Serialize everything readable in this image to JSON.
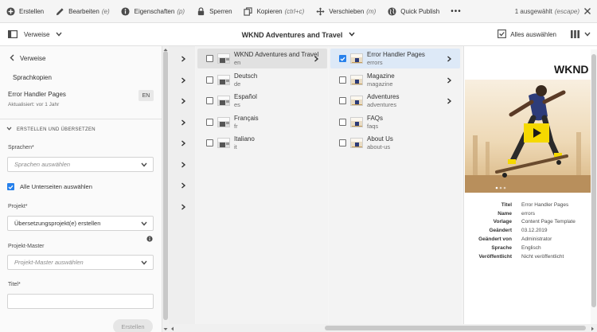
{
  "actionbar": {
    "create": "Erstellen",
    "edit": "Bearbeiten",
    "edit_kbd": "(e)",
    "properties": "Eigenschaften",
    "properties_kbd": "(p)",
    "lock": "Sperren",
    "copy": "Kopieren",
    "copy_kbd": "(ctrl+c)",
    "move": "Verschieben",
    "move_kbd": "(m)",
    "quick_publish": "Quick Publish",
    "more": "•••",
    "selection_info": "1 ausgewählt",
    "selection_kbd": "(escape)"
  },
  "titlebar": {
    "rail_toggle": "Verweise",
    "title": "WKND Adventures and Travel",
    "select_all": "Alles auswählen"
  },
  "rail": {
    "back_label": "Verweise",
    "subtitle": "Sprachkopien",
    "page_title": "Error Handler Pages",
    "updated": "Aktualisiert: vor 1 Jahr",
    "lang_badge": "EN",
    "section": "ERSTELLEN UND ÜBERSETZEN",
    "languages_label": "Sprachen*",
    "languages_placeholder": "Sprachen auswählen",
    "subpages_label": "Alle Unterseiten auswählen",
    "subpages_checked": true,
    "project_label": "Projekt*",
    "project_value": "Übersetzungsprojekt(e) erstellen",
    "master_label": "Projekt-Master",
    "master_placeholder": "Projekt-Master auswählen",
    "title_label": "Titel*",
    "title_value": "",
    "create_button": "Erstellen"
  },
  "columns": {
    "col1": [
      {
        "title": "WKND Adventures and Travel",
        "sub": "en",
        "state": "highlight",
        "has_children": true
      },
      {
        "title": "Deutsch",
        "sub": "de",
        "state": "none",
        "has_children": false
      },
      {
        "title": "Español",
        "sub": "es",
        "state": "none",
        "has_children": false
      },
      {
        "title": "Français",
        "sub": "fr",
        "state": "none",
        "has_children": false
      },
      {
        "title": "Italiano",
        "sub": "it",
        "state": "none",
        "has_children": false
      }
    ],
    "col2": [
      {
        "title": "Error Handler Pages",
        "sub": "errors",
        "state": "selected",
        "has_children": true
      },
      {
        "title": "Magazine",
        "sub": "magazine",
        "state": "none",
        "has_children": true
      },
      {
        "title": "Adventures",
        "sub": "adventures",
        "state": "none",
        "has_children": true
      },
      {
        "title": "FAQs",
        "sub": "faqs",
        "state": "none",
        "has_children": false
      },
      {
        "title": "About Us",
        "sub": "about-us",
        "state": "none",
        "has_children": false
      }
    ]
  },
  "preview": {
    "logo": "WKND S",
    "meta": [
      {
        "key": "Titel",
        "value": "Error Handler Pages"
      },
      {
        "key": "Name",
        "value": "errors"
      },
      {
        "key": "Vorlage",
        "value": "Content Page Template"
      },
      {
        "key": "Geändert",
        "value": "03.12.2019"
      },
      {
        "key": "Geändert von",
        "value": "Administrator"
      },
      {
        "key": "Sprache",
        "value": "Englisch"
      },
      {
        "key": "Veröffentlicht",
        "value": "Nicht veröffentlicht"
      }
    ]
  },
  "colors": {
    "accent": "#2680eb",
    "selected_row": "#dde9f7",
    "play_button": "#f5d900"
  }
}
